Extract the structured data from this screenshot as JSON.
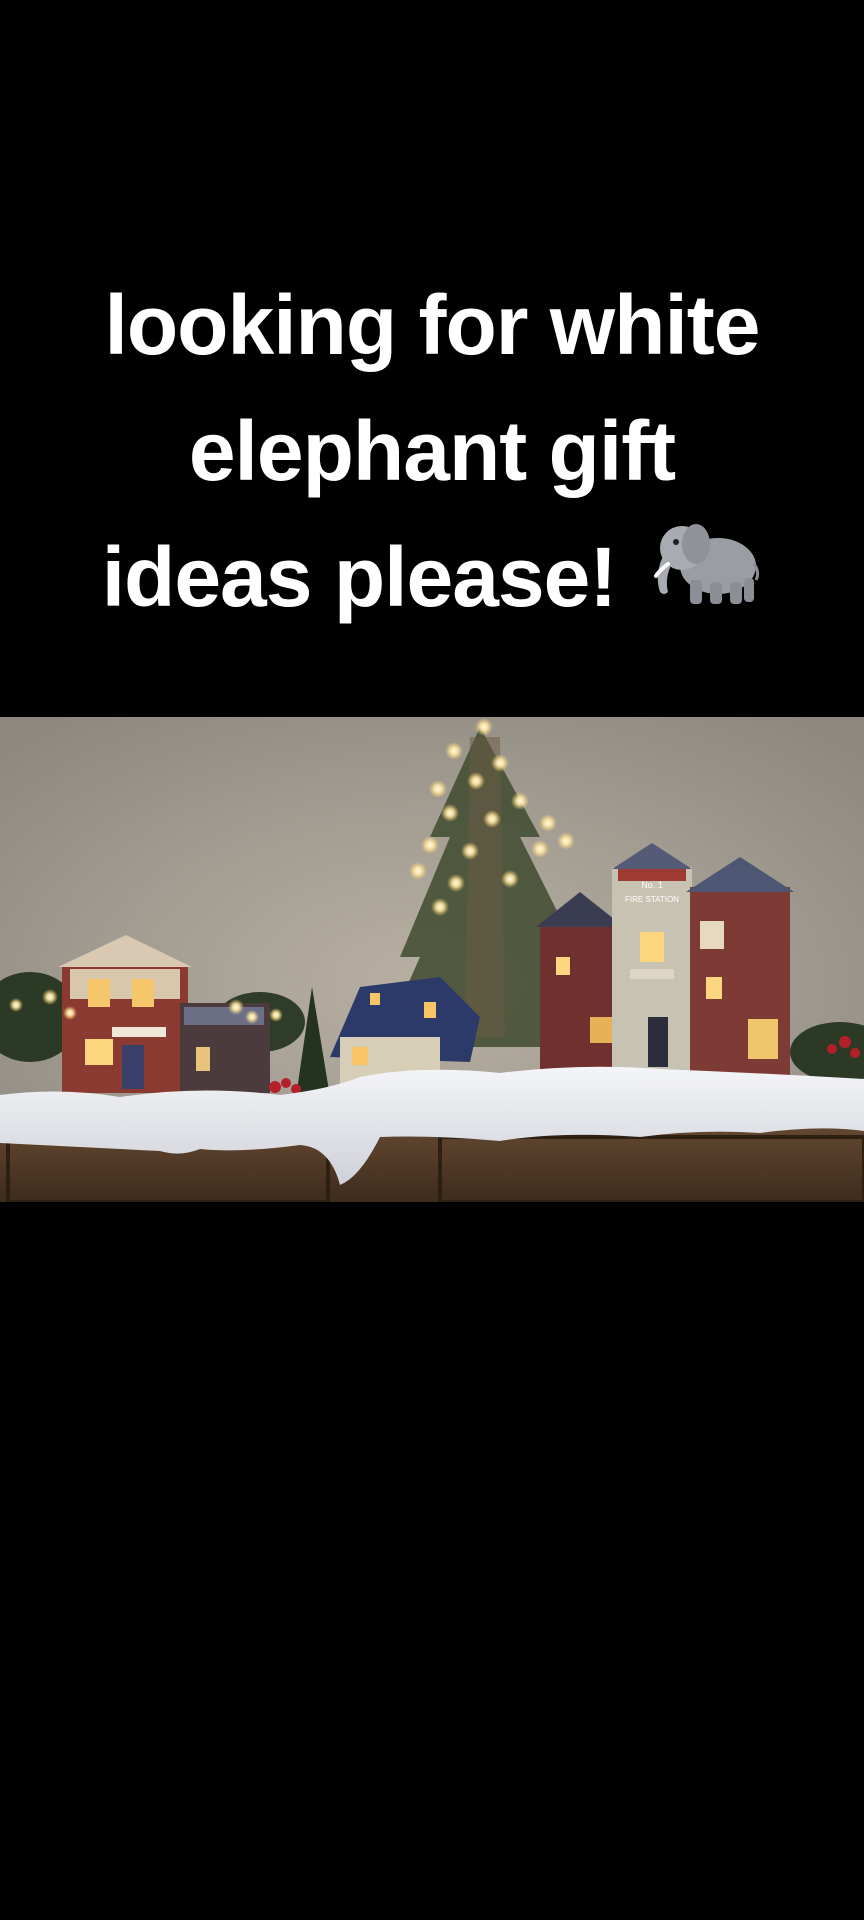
{
  "caption": {
    "line1": "looking for white",
    "line2": "elephant gift",
    "line3": "ideas please!",
    "emoji": "elephant-emoji"
  },
  "scene": {
    "sign_no1": "No. 1",
    "sign_station": "FIRE STATION",
    "colors": {
      "background": "#000000",
      "wall": "#a39d93",
      "snow": "#e9eaee",
      "cabinet": "#5a412b",
      "tree": "#3d4a2e",
      "light": "#fff3c2"
    }
  }
}
